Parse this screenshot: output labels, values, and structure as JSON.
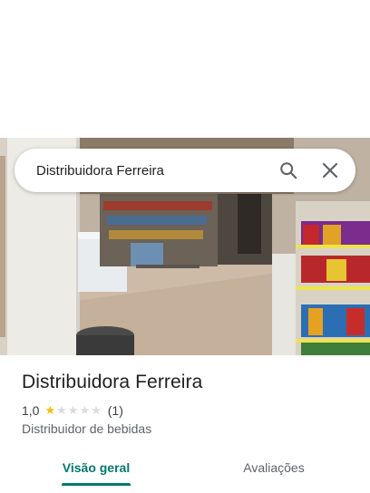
{
  "search": {
    "query": "Distribuidora Ferreira",
    "search_icon": "search-icon",
    "clear_icon": "close-icon"
  },
  "place": {
    "name": "Distribuidora Ferreira",
    "rating_text": "1,0",
    "rating_value": 1.0,
    "stars_max": 5,
    "review_count": "(1)",
    "category": "Distribuidor de bebidas"
  },
  "photo": {
    "description_icon": "store-photo"
  },
  "tabs": [
    {
      "label": "Visão geral",
      "active": true
    },
    {
      "label": "Avaliações",
      "active": false
    }
  ],
  "colors": {
    "accent": "#00796b",
    "star": "#fbbc04",
    "star_empty": "#dadce0"
  }
}
